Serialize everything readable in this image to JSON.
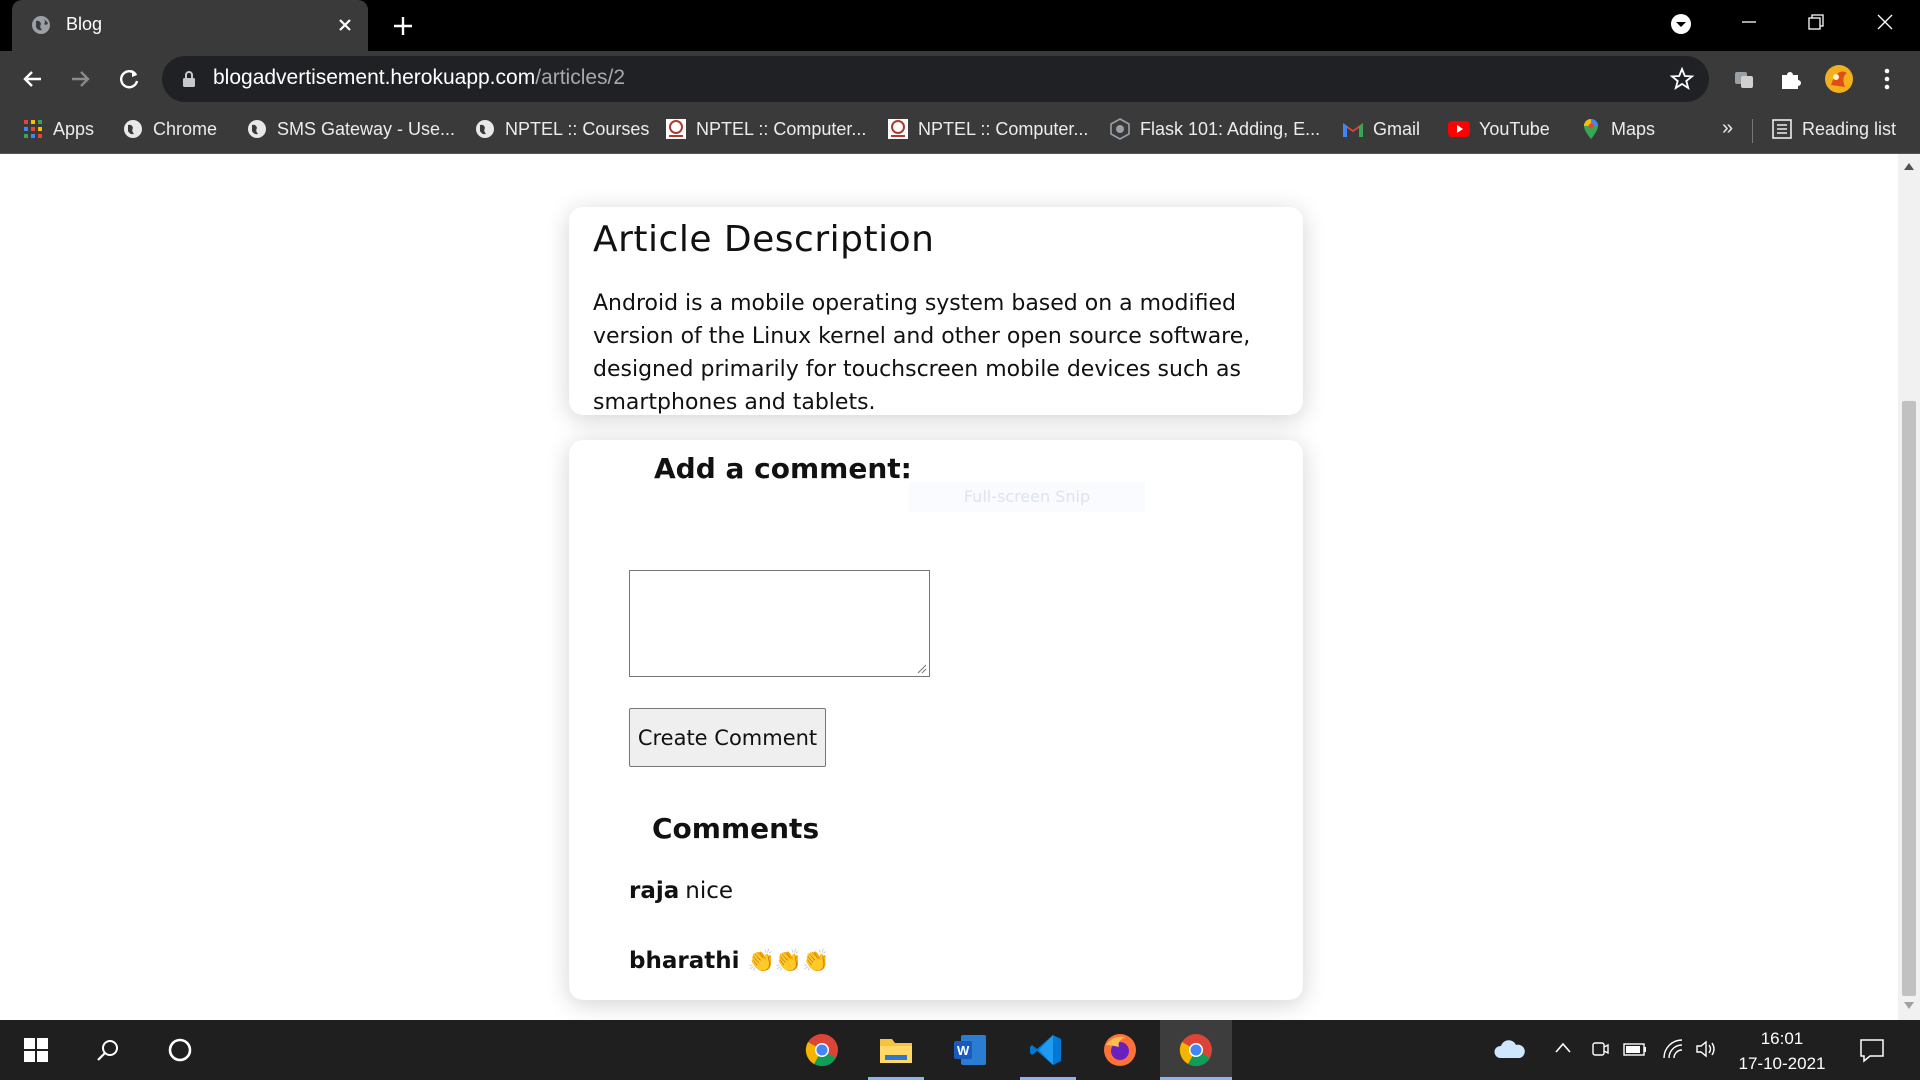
{
  "browser": {
    "tab_title": "Blog",
    "url_host": "blogadvertisement.herokuapp.com",
    "url_path": "/articles/2",
    "reading_list": "Reading list",
    "more_bookmarks": "»"
  },
  "bookmarks": [
    {
      "label": "Apps",
      "icon": "apps-grid-icon"
    },
    {
      "label": "Chrome",
      "icon": "globe-icon"
    },
    {
      "label": "SMS Gateway - Use...",
      "icon": "globe-icon"
    },
    {
      "label": "NPTEL :: Courses",
      "icon": "globe-icon"
    },
    {
      "label": "NPTEL :: Computer...",
      "icon": "nptel-icon"
    },
    {
      "label": "NPTEL :: Computer...",
      "icon": "nptel-icon"
    },
    {
      "label": "Flask 101: Adding, E...",
      "icon": "flask-icon"
    },
    {
      "label": "Gmail",
      "icon": "gmail-icon"
    },
    {
      "label": "YouTube",
      "icon": "youtube-icon"
    },
    {
      "label": "Maps",
      "icon": "maps-icon"
    }
  ],
  "article": {
    "heading": "Article Description",
    "body": "Android is a mobile operating system based on a modified version of the Linux kernel and other open source software, designed primarily for touchscreen mobile devices such as smartphones and tablets."
  },
  "comment_form": {
    "heading": "Add a comment:",
    "overlay_text": "Full-screen Snip",
    "textarea_value": "",
    "submit_label": "Create Comment"
  },
  "comments": {
    "heading": "Comments",
    "items": [
      {
        "author": "raja",
        "text": "nice"
      },
      {
        "author": "bharathi",
        "text": "👏👏👏"
      }
    ]
  },
  "taskbar": {
    "time": "16:01",
    "date": "17-10-2021"
  },
  "colors": {
    "chrome_dark": "#3a3a3a",
    "tab_strip": "#000000",
    "taskbar": "#1f1f1f",
    "card_bg": "#ffffff"
  }
}
